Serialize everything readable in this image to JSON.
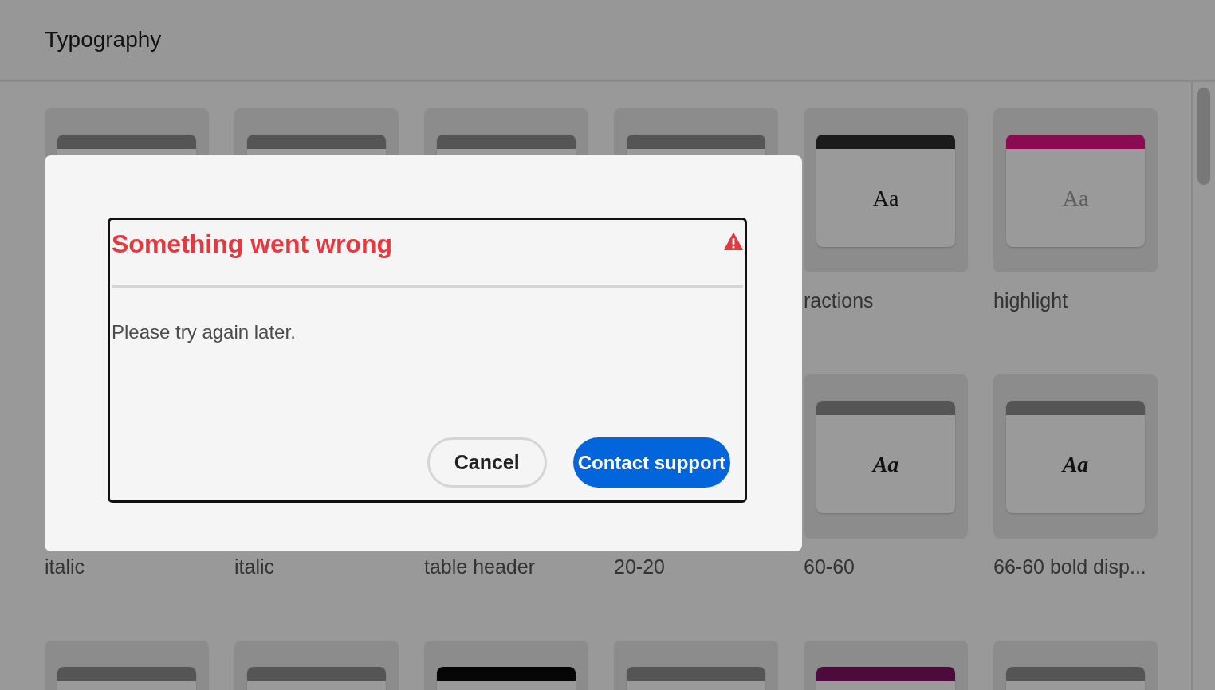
{
  "header": {
    "title": "Typography"
  },
  "cards": [
    {
      "color": "#555555"
    },
    {
      "color": "#555555"
    },
    {
      "color": "#555555"
    },
    {
      "color": "#555555"
    },
    {
      "color": "#1b1b1b",
      "kind": "plain",
      "sample": "Aa",
      "label": "ractions"
    },
    {
      "color": "#8b0b52",
      "kind": "muted",
      "sample": "Aa",
      "label": "highlight"
    },
    {
      "label": "italic"
    },
    {
      "label": "italic"
    },
    {
      "label": "table header"
    },
    {
      "label": "20-20"
    },
    {
      "color": "#555555",
      "kind": "bold",
      "sample": "Aa",
      "label": "60-60"
    },
    {
      "color": "#555555",
      "kind": "bold",
      "sample": "Aa",
      "label": "66-60 bold disp..."
    },
    {
      "color": "#555555"
    },
    {
      "color": "#555555"
    },
    {
      "color": "#050505"
    },
    {
      "color": "#555555"
    },
    {
      "color": "#4d0a3c"
    },
    {
      "color": "#555555"
    }
  ],
  "dialog": {
    "title": "Something went wrong",
    "message": "Please try again later.",
    "buttons": [
      {
        "label": "Cancel",
        "kind": "secondary"
      },
      {
        "label": "Contact support",
        "kind": "primary"
      }
    ]
  }
}
